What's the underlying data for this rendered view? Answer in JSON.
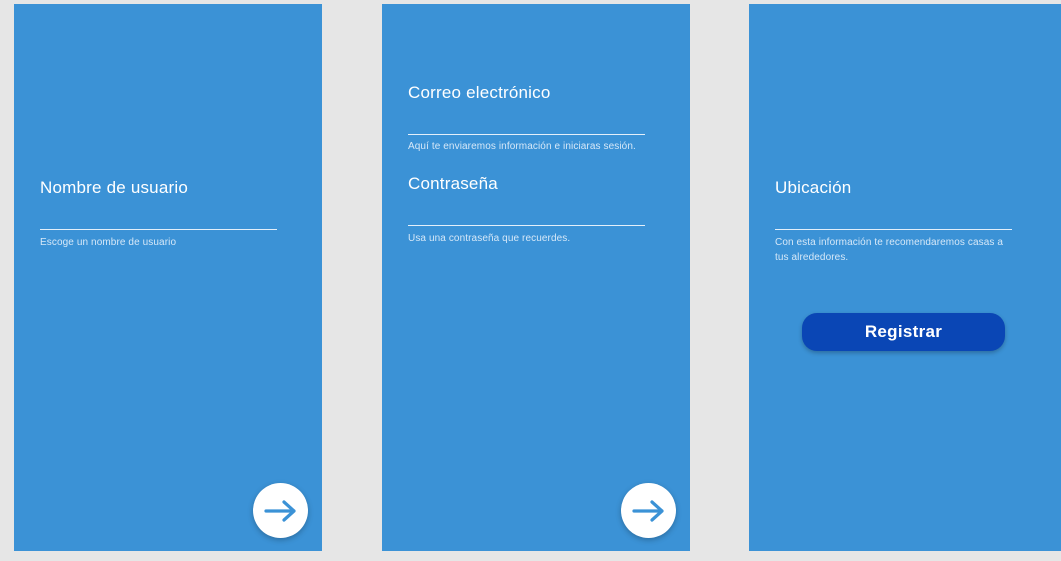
{
  "screens": [
    {
      "fields": [
        {
          "label": "Nombre de usuario",
          "help": "Escoge un nombre de usuario"
        }
      ],
      "next_icon": "arrow-right-icon"
    },
    {
      "fields": [
        {
          "label": "Correo electrónico",
          "help": "Aquí te enviaremos información e iniciaras sesión."
        },
        {
          "label": "Contraseña",
          "help": "Usa una contraseña que recuerdes."
        }
      ],
      "next_icon": "arrow-right-icon"
    },
    {
      "fields": [
        {
          "label": "Ubicación",
          "help": "Con esta información te recomendaremos casas a tus alrededores."
        }
      ],
      "register_label": "Registrar"
    }
  ],
  "colors": {
    "background": "#e6e6e6",
    "screen": "#3b92d6",
    "primary_button": "#0a46b5",
    "arrow": "#3b92d6"
  }
}
